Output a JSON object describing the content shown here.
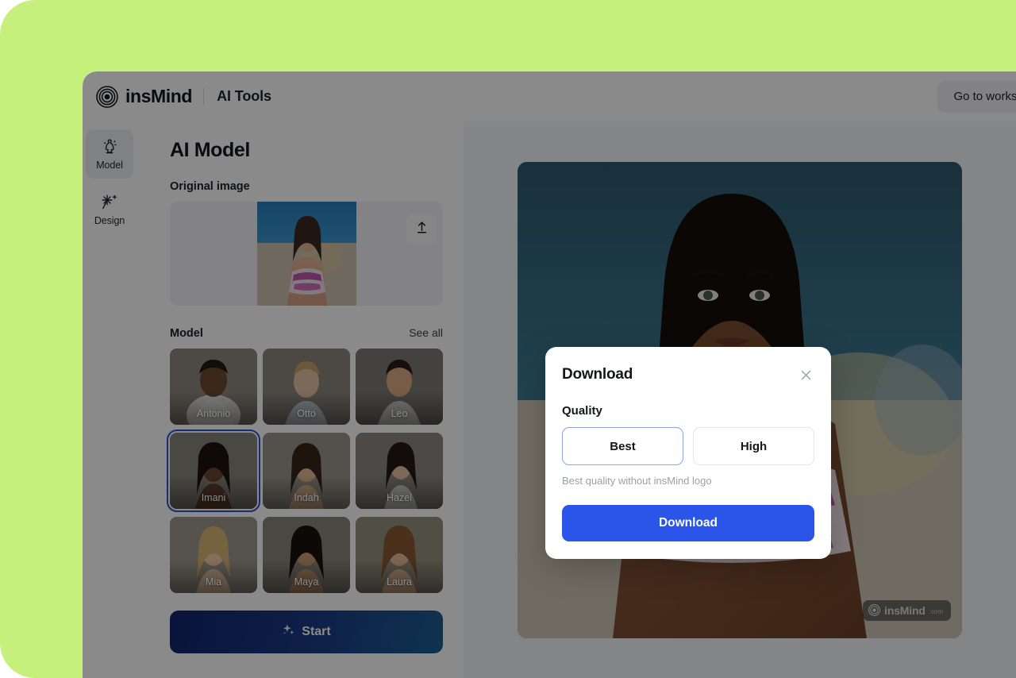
{
  "theme": {
    "backdrop_color": "#c4f07b",
    "accent_blue": "#2b54e8",
    "selected_border": "#2b54d4"
  },
  "topbar": {
    "brand_name": "insMind",
    "tool_name": "AI Tools",
    "logo_icon": "insmind-target-logo-icon",
    "workspace_button": "Go to workspace"
  },
  "rail": {
    "items": [
      {
        "label": "Model",
        "icon": "mannequin-icon",
        "active": true
      },
      {
        "label": "Design",
        "icon": "magic-wand-icon",
        "active": false
      }
    ]
  },
  "panel": {
    "title": "AI Model",
    "original_image_label": "Original image",
    "upload_icon": "upload-arrow-icon",
    "model_label": "Model",
    "see_all": "See all",
    "models": [
      {
        "name": "Antonio",
        "selected": false
      },
      {
        "name": "Otto",
        "selected": false
      },
      {
        "name": "Leo",
        "selected": false
      },
      {
        "name": "Imani",
        "selected": true
      },
      {
        "name": "Indah",
        "selected": false
      },
      {
        "name": "Hazel",
        "selected": false
      },
      {
        "name": "Mia",
        "selected": false
      },
      {
        "name": "Maya",
        "selected": false
      },
      {
        "name": "Laura",
        "selected": false
      }
    ],
    "start_button": "Start",
    "start_icon": "sparkle-icon"
  },
  "preview": {
    "watermark_text": "insMind",
    "watermark_tld": ".com",
    "watermark_icon": "insmind-target-logo-icon"
  },
  "modal": {
    "title": "Download",
    "close_icon": "close-icon",
    "quality_label": "Quality",
    "quality_options": [
      {
        "label": "Best",
        "selected": true
      },
      {
        "label": "High",
        "selected": false
      }
    ],
    "hint": "Best quality without insMind logo",
    "primary_button": "Download"
  }
}
